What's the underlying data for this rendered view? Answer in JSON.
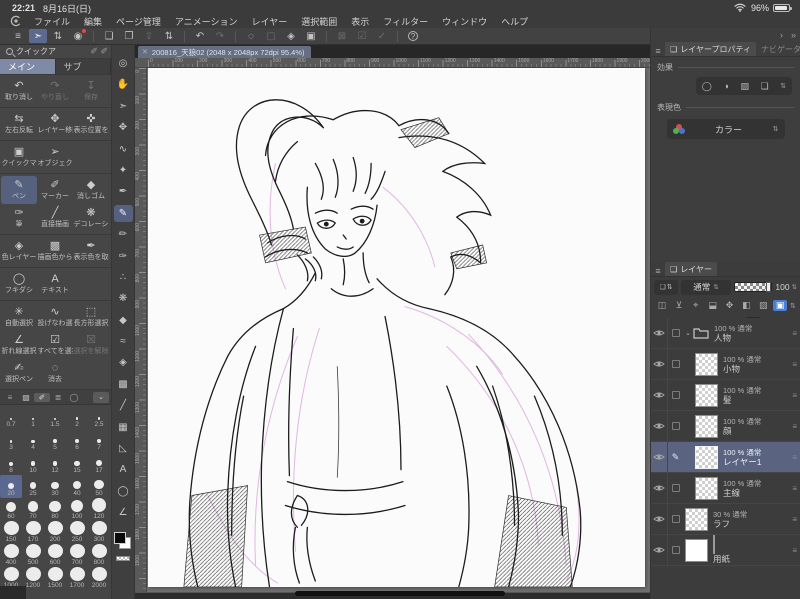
{
  "status_bar": {
    "time": "22:21",
    "date": "8月16日(日)",
    "battery_percent": "96%"
  },
  "menu_bar": {
    "items": [
      "ファイル",
      "編集",
      "ページ管理",
      "アニメーション",
      "レイヤー",
      "選択範囲",
      "表示",
      "フィルター",
      "ウィンドウ",
      "ヘルプ"
    ]
  },
  "command_bar": {
    "groups": [
      [
        {
          "name": "main-menu",
          "glyph": "≡"
        },
        {
          "name": "edit-mode-toggle",
          "glyph": "➣",
          "active": true
        },
        {
          "name": "tool-stepper",
          "glyph": "⇅"
        },
        {
          "name": "timelapse-record",
          "glyph": "◉",
          "badge": true
        }
      ],
      [
        {
          "name": "new-canvas",
          "glyph": "❏"
        },
        {
          "name": "open-file",
          "glyph": "❐"
        },
        {
          "name": "export",
          "glyph": "⇪",
          "disabled": true
        },
        {
          "name": "page-stepper",
          "glyph": "⇅"
        }
      ],
      [
        {
          "name": "undo",
          "glyph": "↶"
        },
        {
          "name": "redo",
          "glyph": "↷",
          "disabled": true
        }
      ],
      [
        {
          "name": "snap",
          "glyph": "◌"
        },
        {
          "name": "grid",
          "glyph": "▢",
          "disabled": true
        },
        {
          "name": "fill",
          "glyph": "◈"
        },
        {
          "name": "transform",
          "glyph": "▣"
        }
      ],
      [
        {
          "name": "deselect",
          "glyph": "⊠",
          "disabled": true
        },
        {
          "name": "select-to-layer",
          "glyph": "☑",
          "disabled": true
        },
        {
          "name": "select-from-layer",
          "glyph": "✓",
          "disabled": true
        }
      ],
      [
        {
          "name": "help",
          "glyph": "?",
          "help": true
        }
      ]
    ],
    "overflow_back": "›",
    "overflow_more": "»"
  },
  "document_tab": {
    "close": "✕",
    "title": "200816_天狼02 (2048 x 2048px 72dpi 95.4%)"
  },
  "quick_access": {
    "title": "クイックア",
    "header_icons": [
      "✐",
      "✐"
    ],
    "tabs": [
      {
        "label": "メイン",
        "active": true
      },
      {
        "label": "サブ",
        "active": false
      }
    ],
    "groups": [
      [
        {
          "label": "取り消し",
          "glyph": "↶"
        },
        {
          "label": "やり直し",
          "glyph": "↷",
          "disabled": true
        },
        {
          "label": "保存",
          "glyph": "↧",
          "disabled": true
        }
      ],
      [
        {
          "label": "左右反転",
          "glyph": "⇆"
        },
        {
          "label": "レイヤー移動",
          "glyph": "✥"
        },
        {
          "label": "表示位置を戻す",
          "glyph": "✜"
        }
      ],
      [
        {
          "label": "クイックマスク",
          "glyph": "▣"
        },
        {
          "label": "オブジェクト",
          "glyph": "➢"
        }
      ],
      [
        {
          "label": "ペン",
          "glyph": "✎",
          "selected": true
        },
        {
          "label": "マーカー",
          "glyph": "✐"
        },
        {
          "label": "消しゴム",
          "glyph": "◆"
        },
        {
          "label": "筆",
          "glyph": "✑"
        },
        {
          "label": "直接描画",
          "glyph": "╱"
        },
        {
          "label": "デコレーション",
          "glyph": "❋"
        }
      ],
      [
        {
          "label": "色レイヤー",
          "glyph": "◈"
        },
        {
          "label": "描画色から",
          "glyph": "▩"
        },
        {
          "label": "表示色を取得",
          "glyph": "✒"
        }
      ],
      [
        {
          "label": "フキダシ",
          "glyph": "◯"
        },
        {
          "label": "テキスト",
          "glyph": "A"
        }
      ],
      [
        {
          "label": "自動選択",
          "glyph": "✳"
        },
        {
          "label": "投げなわ選択",
          "glyph": "∿"
        },
        {
          "label": "長方形選択",
          "glyph": "⬚"
        },
        {
          "label": "折れ線選択",
          "glyph": "∠"
        },
        {
          "label": "すべてを選択",
          "glyph": "☑"
        },
        {
          "label": "選択を解除",
          "glyph": "☒",
          "disabled": true
        },
        {
          "label": "選択ペン",
          "glyph": "✍"
        },
        {
          "label": "消去",
          "glyph": "◌"
        }
      ]
    ],
    "minitabs": [
      "≡",
      "▩",
      "✐",
      "≣",
      "◯"
    ],
    "minitab_chevron": "⌄",
    "brush_sizes": {
      "values": [
        "0.7",
        "1",
        "1.5",
        "2",
        "2.5",
        "3",
        "4",
        "5",
        "6",
        "7",
        "8",
        "10",
        "12",
        "15",
        "17",
        "20",
        "25",
        "30",
        "40",
        "50",
        "60",
        "70",
        "80",
        "100",
        "120",
        "150",
        "170",
        "200",
        "250",
        "300",
        "400",
        "500",
        "600",
        "700",
        "800",
        "1000",
        "1200",
        "1500",
        "1700",
        "2000"
      ],
      "selected": "20"
    }
  },
  "tool_column": {
    "tools": [
      {
        "name": "zoom",
        "glyph": "◎"
      },
      {
        "name": "hand",
        "glyph": "✋"
      },
      {
        "name": "operate",
        "glyph": "➣"
      },
      {
        "name": "layer-move",
        "glyph": "✥"
      },
      {
        "name": "selection",
        "glyph": "∿"
      },
      {
        "name": "auto-select",
        "glyph": "✦"
      },
      {
        "name": "eyedropper",
        "glyph": "✒"
      },
      {
        "name": "pen",
        "glyph": "✎",
        "selected": true
      },
      {
        "name": "pencil",
        "glyph": "✏"
      },
      {
        "name": "brush",
        "glyph": "✑"
      },
      {
        "name": "airbrush",
        "glyph": "∴"
      },
      {
        "name": "decoration",
        "glyph": "❋"
      },
      {
        "name": "eraser",
        "glyph": "◆"
      },
      {
        "name": "blend",
        "glyph": "≈"
      },
      {
        "name": "fill",
        "glyph": "◈"
      },
      {
        "name": "gradient",
        "glyph": "▩"
      },
      {
        "name": "figure",
        "glyph": "╱"
      },
      {
        "name": "frame",
        "glyph": "▦"
      },
      {
        "name": "ruler",
        "glyph": "◺"
      },
      {
        "name": "text",
        "glyph": "A"
      },
      {
        "name": "balloon",
        "glyph": "◯"
      },
      {
        "name": "line-correct",
        "glyph": "∠"
      }
    ]
  },
  "canvas": {
    "ruler_labels": [
      "0",
      "100",
      "200",
      "300",
      "400",
      "500",
      "600",
      "700",
      "800",
      "900",
      "1000",
      "1100",
      "1200",
      "1300",
      "1400",
      "1500",
      "1600",
      "1700",
      "1800",
      "1900",
      "2000"
    ]
  },
  "layer_property": {
    "menu": "≡",
    "tab": "レイヤープロパティ",
    "tab_icon": "❏",
    "tab2": "ナビゲーター",
    "effect_label": "効果",
    "effect_buttons": [
      "◯",
      "◑",
      "▨",
      "❏"
    ],
    "effect_stepper": "⇅",
    "expression_label": "表現色",
    "expression_value": "カラー",
    "expression_stepper": "⇅"
  },
  "layers_panel": {
    "menu": "≡",
    "tab": "レイヤー",
    "tab_icon": "❏",
    "palette_glyph": "❏",
    "blend_mode": "通常",
    "stepper": "⇅",
    "opacity_value": "100",
    "lock_icons": [
      "◫",
      "⊻",
      "⌖",
      "⬓",
      "✥",
      "◧",
      "▨"
    ],
    "lock_active": "▣",
    "new_icons": [
      "❏",
      "❑",
      "⊞",
      "↓",
      "↳",
      "◉",
      "▢",
      "♺"
    ],
    "row_menu": "≡",
    "expand_chevron": "⌄",
    "layers": [
      {
        "name": "人物",
        "info": "100 % 通常",
        "type": "folder",
        "indent": 0,
        "expanded": true
      },
      {
        "name": "小物",
        "info": "100 % 通常",
        "indent": 1
      },
      {
        "name": "髪",
        "info": "100 % 通常",
        "indent": 1
      },
      {
        "name": "顔",
        "info": "100 % 通常",
        "indent": 1
      },
      {
        "name": "レイヤー1",
        "info": "100 % 通常",
        "indent": 1,
        "selected": true,
        "editing": true
      },
      {
        "name": "主線",
        "info": "100 % 通常",
        "indent": 1
      },
      {
        "name": "ラフ",
        "info": "30 % 通常",
        "indent": 0
      },
      {
        "name": "用紙",
        "info": "",
        "indent": 0,
        "type": "paper"
      }
    ]
  }
}
